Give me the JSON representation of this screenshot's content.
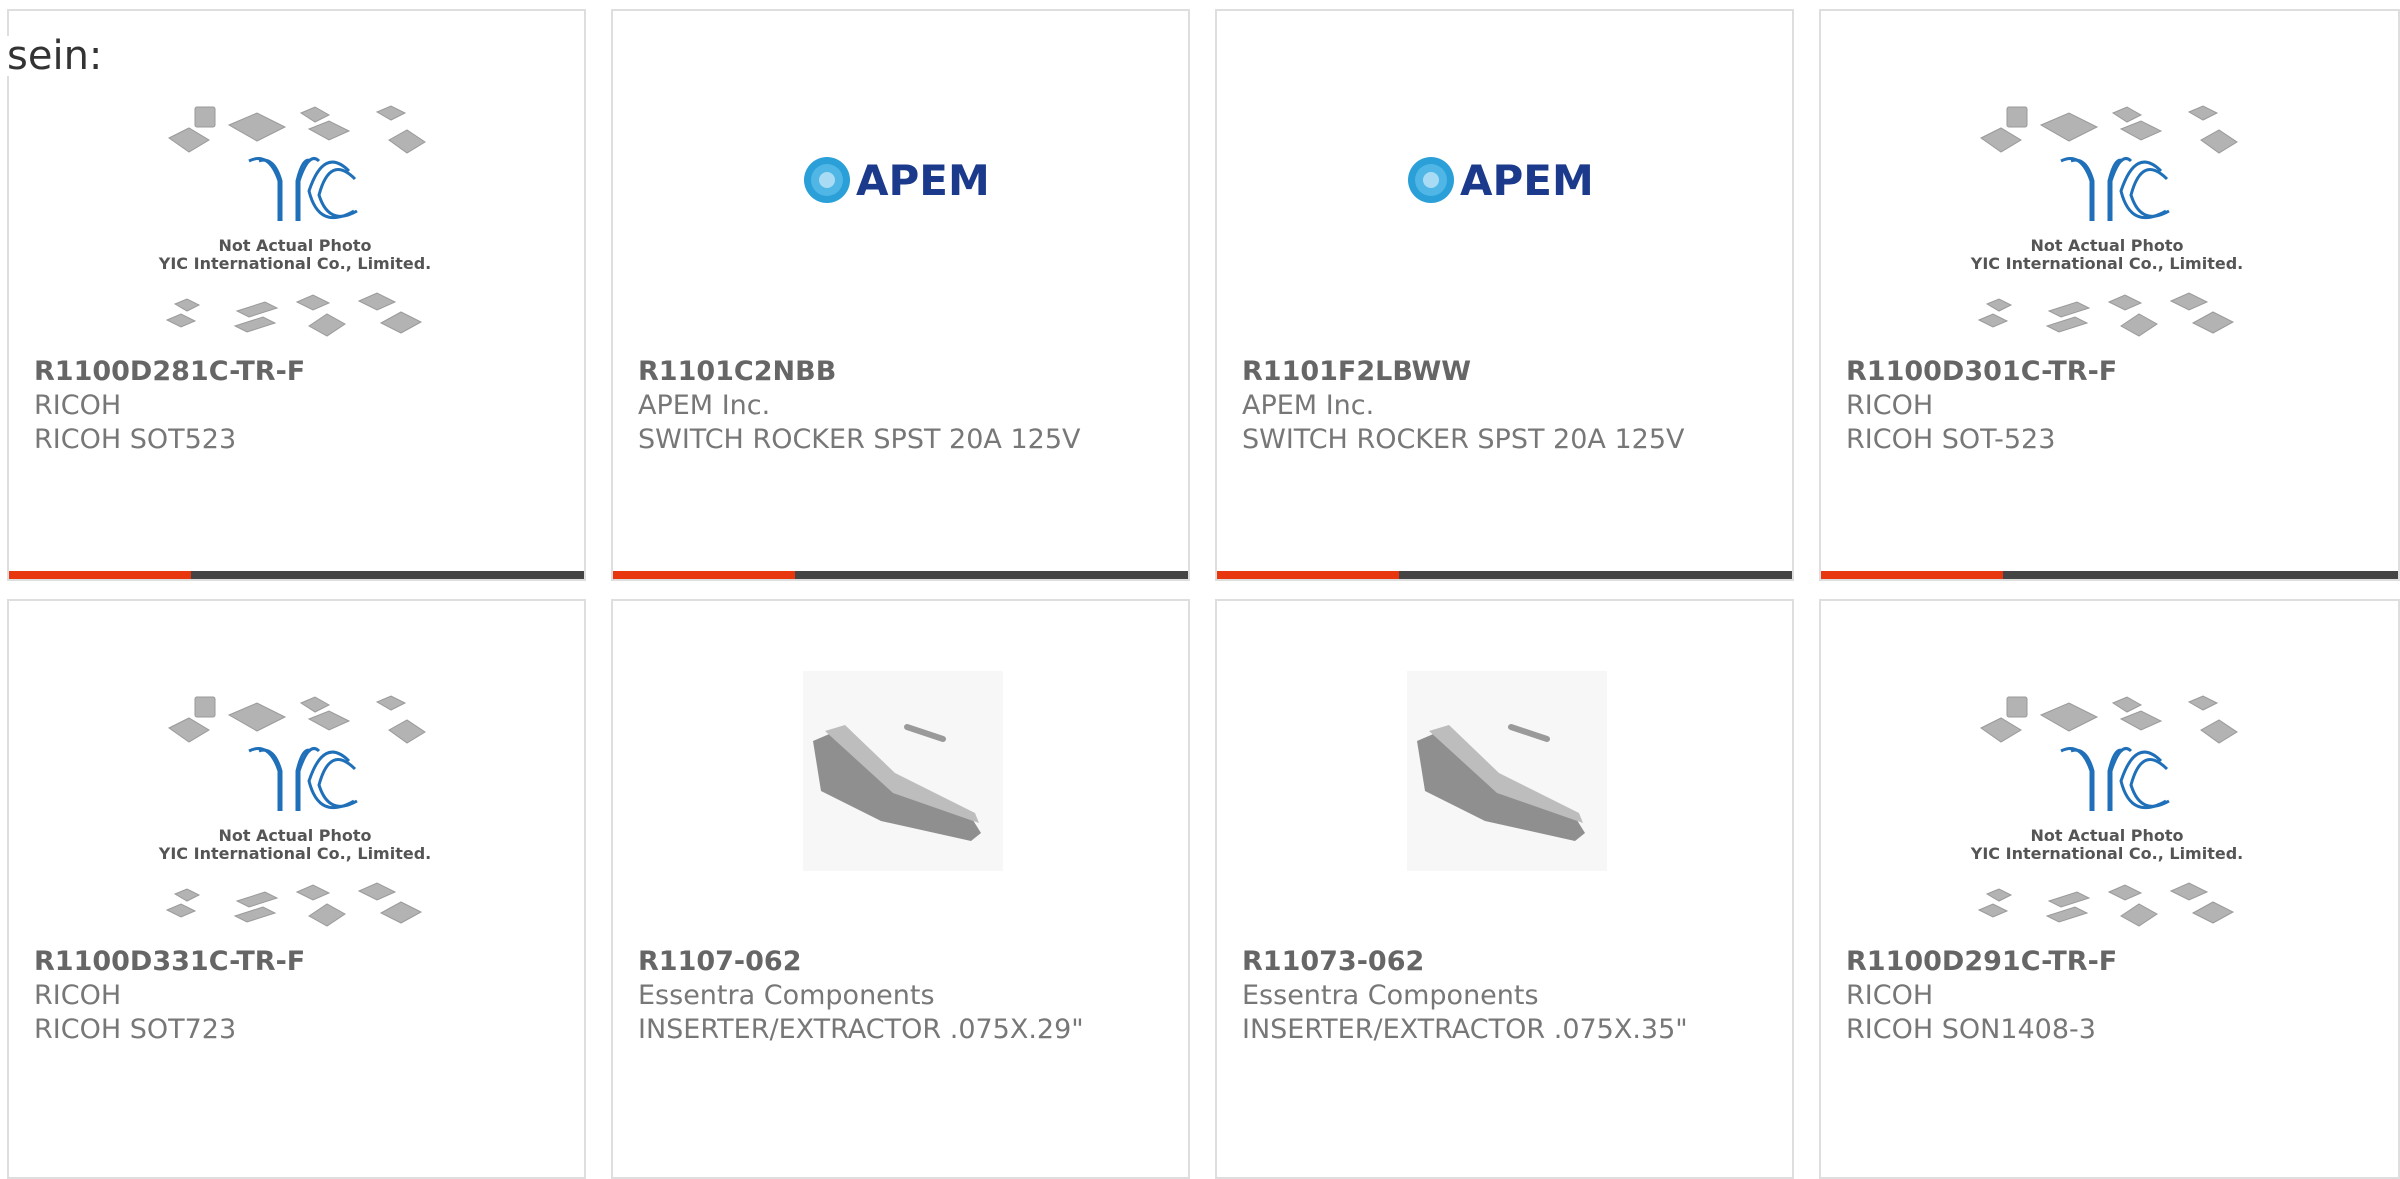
{
  "lead_text": "sein:",
  "brand": {
    "accent": "#e8360e",
    "bar": "#444444",
    "border": "#dedede",
    "yic_blue": "#1f70b8",
    "apem_navy": "#1b3a8c"
  },
  "placeholder": {
    "line1": "Not Actual Photo",
    "line2": "YIC International Co., Limited.",
    "logo": "YIC"
  },
  "apem_logo_text": "APEM",
  "products": [
    {
      "part": "R1100D281C-TR-F",
      "manufacturer": "RICOH",
      "description": "RICOH SOT523",
      "image": "yic-placeholder"
    },
    {
      "part": "R1101C2NBB",
      "manufacturer": "APEM Inc.",
      "description": "SWITCH ROCKER SPST 20A 125V",
      "image": "apem-logo"
    },
    {
      "part": "R1101F2LBWW",
      "manufacturer": "APEM Inc.",
      "description": "SWITCH ROCKER SPST 20A 125V",
      "image": "apem-logo"
    },
    {
      "part": "R1100D301C-TR-F",
      "manufacturer": "RICOH",
      "description": "RICOH SOT-523",
      "image": "yic-placeholder"
    },
    {
      "part": "R1100D331C-TR-F",
      "manufacturer": "RICOH",
      "description": "RICOH SOT723",
      "image": "yic-placeholder"
    },
    {
      "part": "R1107-062",
      "manufacturer": "Essentra Components",
      "description": "INSERTER/EXTRACTOR .075X.29\"",
      "image": "tool-photo"
    },
    {
      "part": "R11073-062",
      "manufacturer": "Essentra Components",
      "description": "INSERTER/EXTRACTOR .075X.35\"",
      "image": "tool-photo"
    },
    {
      "part": "R1100D291C-TR-F",
      "manufacturer": "RICOH",
      "description": "RICOH SON1408-3",
      "image": "yic-placeholder"
    }
  ]
}
